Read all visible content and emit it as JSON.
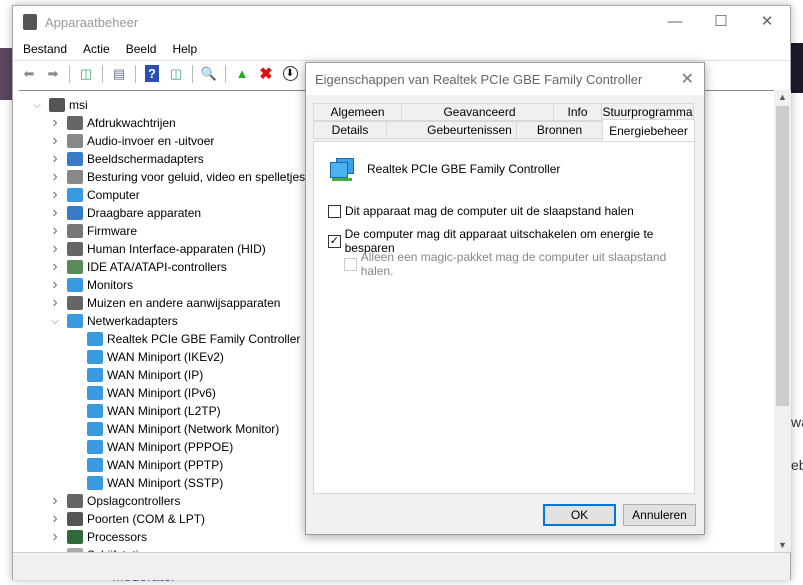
{
  "window": {
    "title": "Apparaatbeheer"
  },
  "menu": [
    "Bestand",
    "Actie",
    "Beeld",
    "Help"
  ],
  "tree": {
    "root": "msi",
    "categories": [
      {
        "label": "Afdrukwachtrijen",
        "color": "#666"
      },
      {
        "label": "Audio-invoer en -uitvoer",
        "color": "#888"
      },
      {
        "label": "Beeldschermadapters",
        "color": "#3a7bc8"
      },
      {
        "label": "Besturing voor geluid, video en spelletjes",
        "color": "#888"
      },
      {
        "label": "Computer",
        "color": "#3a9ae0"
      },
      {
        "label": "Draagbare apparaten",
        "color": "#3a7bc8"
      },
      {
        "label": "Firmware",
        "color": "#777"
      },
      {
        "label": "Human Interface-apparaten (HID)",
        "color": "#666"
      },
      {
        "label": "IDE ATA/ATAPI-controllers",
        "color": "#5a8a5a"
      },
      {
        "label": "Monitors",
        "color": "#3a9ae0"
      },
      {
        "label": "Muizen en andere aanwijsapparaten",
        "color": "#666"
      },
      {
        "label": "Netwerkadapters",
        "color": "#3a9ae0",
        "expanded": true
      }
    ],
    "network_children": [
      "Realtek PCIe GBE Family Controller",
      "WAN Miniport (IKEv2)",
      "WAN Miniport (IP)",
      "WAN Miniport (IPv6)",
      "WAN Miniport (L2TP)",
      "WAN Miniport (Network Monitor)",
      "WAN Miniport (PPPOE)",
      "WAN Miniport (PPTP)",
      "WAN Miniport (SSTP)"
    ],
    "after": [
      {
        "label": "Opslagcontrollers",
        "color": "#666"
      },
      {
        "label": "Poorten (COM & LPT)",
        "color": "#555"
      },
      {
        "label": "Processors",
        "color": "#2e6a3a"
      },
      {
        "label": "Schijfstations",
        "color": "#aaa"
      }
    ]
  },
  "dialog": {
    "title": "Eigenschappen van Realtek PCIe GBE Family Controller",
    "tabs_row1": [
      "Algemeen",
      "Geavanceerd",
      "Info",
      "Stuurprogramma"
    ],
    "tabs_row2": [
      "Details",
      "Gebeurtenissen",
      "Bronnen",
      "Energiebeheer"
    ],
    "device_name": "Realtek PCIe GBE Family Controller",
    "options": [
      {
        "label": "Dit apparaat mag de computer uit de slaapstand halen",
        "checked": false,
        "enabled": true
      },
      {
        "label": "De computer mag dit apparaat uitschakelen om energie te besparen",
        "checked": true,
        "enabled": true
      },
      {
        "label": "Alleen een magic-pakket mag de computer uit slaapstand halen.",
        "checked": false,
        "enabled": false
      }
    ],
    "ok": "OK",
    "cancel": "Annuleren"
  },
  "background": {
    "bottom_text": "Moderator",
    "right_text1": "wa",
    "right_text2": "eb"
  }
}
